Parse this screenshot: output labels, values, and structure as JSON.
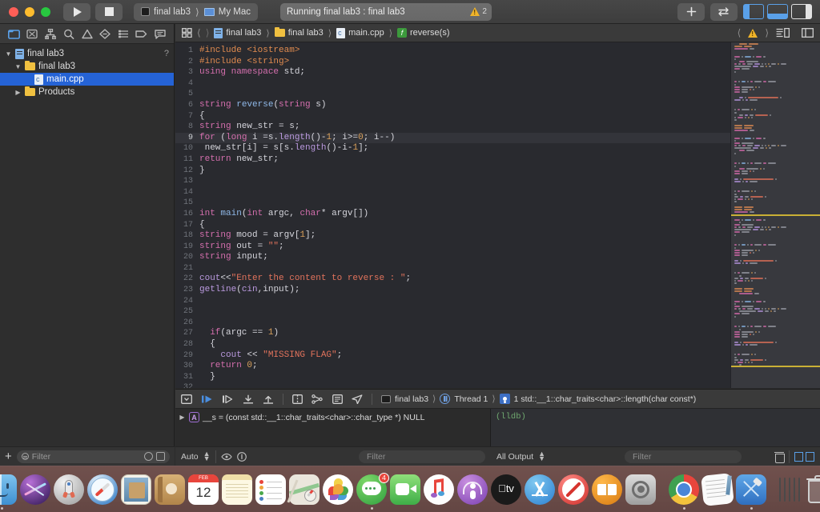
{
  "window": {
    "traffic_lights": [
      "close",
      "minimize",
      "zoom"
    ],
    "scheme_target": "final lab3",
    "scheme_device": "My Mac",
    "status_text": "Running final lab3 : final lab3",
    "warning_count": "2"
  },
  "navigator": {
    "tabs": [
      "folder-icon",
      "source-control-icon",
      "symbol-icon",
      "search-icon",
      "issue-icon",
      "test-icon",
      "debug-icon",
      "breakpoint-icon",
      "report-icon"
    ],
    "tree": [
      {
        "label": "final lab3",
        "icon": "project-icon",
        "depth": 0,
        "disclosure": "open",
        "selected": false,
        "help": "?"
      },
      {
        "label": "final lab3",
        "icon": "folder-icon",
        "depth": 1,
        "disclosure": "open",
        "selected": false
      },
      {
        "label": "main.cpp",
        "icon": "cpp-file-icon",
        "depth": 2,
        "disclosure": "none",
        "selected": true
      },
      {
        "label": "Products",
        "icon": "folder-icon",
        "depth": 1,
        "disclosure": "closed",
        "selected": false
      }
    ],
    "filter_placeholder": "Filter"
  },
  "jumpbar": {
    "crumbs": [
      "final lab3",
      "final lab3",
      "main.cpp",
      "reverse(s)"
    ],
    "crumb_icons": [
      "project-icon",
      "folder-icon",
      "cpp-file-icon",
      "function-icon"
    ]
  },
  "editor": {
    "highlighted_line": 9,
    "lines": [
      {
        "n": 1,
        "tokens": [
          {
            "t": "#include ",
            "c": "pre"
          },
          {
            "t": "<iostream>",
            "c": "pre"
          }
        ]
      },
      {
        "n": 2,
        "tokens": [
          {
            "t": "#include ",
            "c": "pre"
          },
          {
            "t": "<string>",
            "c": "pre"
          }
        ]
      },
      {
        "n": 3,
        "tokens": [
          {
            "t": "using namespace",
            "c": "k"
          },
          {
            "t": " std;",
            "c": "ct"
          }
        ]
      },
      {
        "n": 4,
        "tokens": []
      },
      {
        "n": 5,
        "tokens": []
      },
      {
        "n": 6,
        "tokens": [
          {
            "t": "string",
            "c": "k"
          },
          {
            "t": " ",
            "c": "ct"
          },
          {
            "t": "reverse",
            "c": "fn"
          },
          {
            "t": "(",
            "c": "ct"
          },
          {
            "t": "string",
            "c": "k"
          },
          {
            "t": " s)",
            "c": "ct"
          }
        ]
      },
      {
        "n": 7,
        "tokens": [
          {
            "t": "{",
            "c": "ct"
          }
        ]
      },
      {
        "n": 8,
        "tokens": [
          {
            "t": "string",
            "c": "k"
          },
          {
            "t": " new_str = s;",
            "c": "ct"
          }
        ]
      },
      {
        "n": 9,
        "tokens": [
          {
            "t": "for",
            "c": "k"
          },
          {
            "t": " (",
            "c": "ct"
          },
          {
            "t": "long",
            "c": "k"
          },
          {
            "t": " i =s.",
            "c": "ct"
          },
          {
            "t": "length",
            "c": "mth"
          },
          {
            "t": "()",
            "c": "ct"
          },
          {
            "t": "-",
            "c": "ct"
          },
          {
            "t": "1",
            "c": "num"
          },
          {
            "t": "; i>=",
            "c": "ct"
          },
          {
            "t": "0",
            "c": "num"
          },
          {
            "t": "; i--)",
            "c": "ct"
          }
        ]
      },
      {
        "n": 10,
        "tokens": [
          {
            "t": " new_str[i] = s[s.",
            "c": "ct"
          },
          {
            "t": "length",
            "c": "mth"
          },
          {
            "t": "()-i-",
            "c": "ct"
          },
          {
            "t": "1",
            "c": "num"
          },
          {
            "t": "];",
            "c": "ct"
          }
        ]
      },
      {
        "n": 11,
        "tokens": [
          {
            "t": "return",
            "c": "k"
          },
          {
            "t": " new_str;",
            "c": "ct"
          }
        ]
      },
      {
        "n": 12,
        "tokens": [
          {
            "t": "}",
            "c": "ct"
          }
        ]
      },
      {
        "n": 13,
        "tokens": []
      },
      {
        "n": 14,
        "tokens": []
      },
      {
        "n": 15,
        "tokens": []
      },
      {
        "n": 16,
        "tokens": [
          {
            "t": "int",
            "c": "k"
          },
          {
            "t": " ",
            "c": "ct"
          },
          {
            "t": "main",
            "c": "fn"
          },
          {
            "t": "(",
            "c": "ct"
          },
          {
            "t": "int",
            "c": "k"
          },
          {
            "t": " argc, ",
            "c": "ct"
          },
          {
            "t": "char",
            "c": "k"
          },
          {
            "t": "* argv[])",
            "c": "ct"
          }
        ]
      },
      {
        "n": 17,
        "tokens": [
          {
            "t": "{",
            "c": "ct"
          }
        ]
      },
      {
        "n": 18,
        "tokens": [
          {
            "t": "string",
            "c": "k"
          },
          {
            "t": " mood = argv[",
            "c": "ct"
          },
          {
            "t": "1",
            "c": "num"
          },
          {
            "t": "];",
            "c": "ct"
          }
        ]
      },
      {
        "n": 19,
        "tokens": [
          {
            "t": "string",
            "c": "k"
          },
          {
            "t": " out = ",
            "c": "ct"
          },
          {
            "t": "\"\"",
            "c": "str"
          },
          {
            "t": ";",
            "c": "ct"
          }
        ]
      },
      {
        "n": 20,
        "tokens": [
          {
            "t": "string",
            "c": "k"
          },
          {
            "t": " input;",
            "c": "ct"
          }
        ]
      },
      {
        "n": 21,
        "tokens": []
      },
      {
        "n": 22,
        "tokens": [
          {
            "t": "cout",
            "c": "mth"
          },
          {
            "t": "<<",
            "c": "ct"
          },
          {
            "t": "\"Enter the content to reverse : \"",
            "c": "str"
          },
          {
            "t": ";",
            "c": "ct"
          }
        ]
      },
      {
        "n": 23,
        "tokens": [
          {
            "t": "getline",
            "c": "mth"
          },
          {
            "t": "(",
            "c": "ct"
          },
          {
            "t": "cin",
            "c": "mth"
          },
          {
            "t": ",input);",
            "c": "ct"
          }
        ]
      },
      {
        "n": 24,
        "tokens": []
      },
      {
        "n": 25,
        "tokens": []
      },
      {
        "n": 26,
        "tokens": []
      },
      {
        "n": 27,
        "tokens": [
          {
            "t": "  ",
            "c": "ct"
          },
          {
            "t": "if",
            "c": "k"
          },
          {
            "t": "(argc == ",
            "c": "ct"
          },
          {
            "t": "1",
            "c": "num"
          },
          {
            "t": ")",
            "c": "ct"
          }
        ]
      },
      {
        "n": 28,
        "tokens": [
          {
            "t": "  {",
            "c": "ct"
          }
        ]
      },
      {
        "n": 29,
        "tokens": [
          {
            "t": "    ",
            "c": "ct"
          },
          {
            "t": "cout",
            "c": "mth"
          },
          {
            "t": " << ",
            "c": "ct"
          },
          {
            "t": "\"MISSING FLAG\"",
            "c": "str"
          },
          {
            "t": ";",
            "c": "ct"
          }
        ]
      },
      {
        "n": 30,
        "tokens": [
          {
            "t": "  ",
            "c": "ct"
          },
          {
            "t": "return",
            "c": "k"
          },
          {
            "t": " ",
            "c": "ct"
          },
          {
            "t": "0",
            "c": "num"
          },
          {
            "t": ";",
            "c": "ct"
          }
        ]
      },
      {
        "n": 31,
        "tokens": [
          {
            "t": "  }",
            "c": "ct"
          }
        ]
      },
      {
        "n": 32,
        "tokens": []
      }
    ]
  },
  "debug": {
    "breadcrumb": [
      "final lab3",
      "Thread 1",
      "1 std::__1::char_traits<char>::length(char const*)"
    ],
    "variable_row": "__s = (const std::__1::char_traits<char>::char_type *) NULL",
    "variable_badge": "A",
    "console_prompt": "(lldb)",
    "scope_label": "Auto",
    "output_label": "All Output",
    "filter_placeholder": "Filter"
  },
  "dock": {
    "items": [
      {
        "name": "finder",
        "running": true
      },
      {
        "name": "siri",
        "running": false
      },
      {
        "name": "launchpad",
        "running": false
      },
      {
        "name": "safari",
        "running": false
      },
      {
        "name": "mail",
        "running": false
      },
      {
        "name": "contacts",
        "running": false
      },
      {
        "name": "calendar",
        "running": false,
        "day": "12"
      },
      {
        "name": "notes",
        "running": false
      },
      {
        "name": "reminders",
        "running": false
      },
      {
        "name": "maps",
        "running": false
      },
      {
        "name": "photos",
        "running": false
      },
      {
        "name": "messages",
        "running": true,
        "badge": "4"
      },
      {
        "name": "facetime",
        "running": false
      },
      {
        "name": "music",
        "running": false
      },
      {
        "name": "podcasts",
        "running": false
      },
      {
        "name": "appletv",
        "running": false
      },
      {
        "name": "appstore",
        "running": false
      },
      {
        "name": "no-entry",
        "running": false
      },
      {
        "name": "books",
        "running": false
      },
      {
        "name": "system-preferences",
        "running": false
      },
      {
        "name": "chrome",
        "running": true
      },
      {
        "name": "textedit",
        "running": false
      },
      {
        "name": "xcode",
        "running": true
      }
    ],
    "minimized": [
      "document-window",
      "terminal-window",
      "chrome-window-1",
      "chrome-window-2",
      "video-window"
    ],
    "trash": "trash-icon"
  }
}
